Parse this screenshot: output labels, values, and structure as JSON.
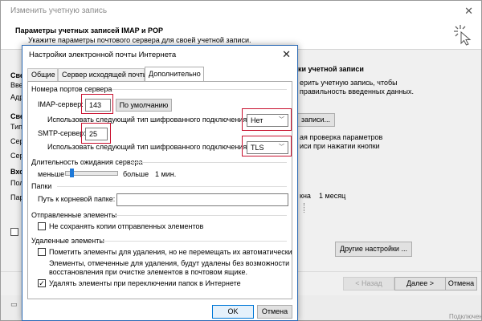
{
  "wizard": {
    "title": "Изменить учетную запись",
    "header_title": "Параметры учетных записей IMAP и POP",
    "header_subtitle": "Укажите параметры почтового сервера для своей учетной записи.",
    "left_fragments": [
      "Све",
      "Вве",
      "Адр",
      "Све",
      "Тип",
      "Сер",
      "Сер",
      "Вхо",
      "Пол",
      "Пар"
    ],
    "right": {
      "title": "ки учетной записи",
      "line1": "ерить учетную запись, чтобы",
      "line2": "правильность введенных данных.",
      "accounts_btn": "записи...",
      "auto_line1": "ая проверка параметров",
      "auto_line2": "иси при нажатии кнопки",
      "period": "кна",
      "period_value": "1 месяц"
    },
    "more_settings_btn": "Другие настройки ...",
    "back_btn": "< Назад",
    "next_btn": "Далее >",
    "cancel_btn": "Отмена",
    "bottom_right_text": "Подключение"
  },
  "dialog": {
    "title": "Настройки электронной почты Интернета",
    "tabs": [
      "Общие",
      "Сервер исходящей почты",
      "Дополнительно"
    ],
    "ports_group": "Номера портов сервера",
    "imap_label": "IMAP-сервер:",
    "imap_port": "143",
    "default_btn": "По умолчанию",
    "imap_enc_label": "Использовать следующий тип шифрованного подключения:",
    "imap_enc_value": "Нет",
    "smtp_label": "SMTP-сервер:",
    "smtp_port": "25",
    "smtp_enc_label": "Использовать следующий тип шифрованного подключения:",
    "smtp_enc_value": "TLS",
    "timeout_group": "Длительность ожидания сервера",
    "timeout_less": "меньше",
    "timeout_more": "больше",
    "timeout_value": "1 мин.",
    "timeout_level_fraction": 0.08,
    "folders_group": "Папки",
    "root_path_label": "Путь к корневой папке:",
    "root_path_value": "",
    "sent_group": "Отправленные элементы",
    "sent_no_copies": "Не сохранять копии отправленных элементов",
    "sent_no_copies_checked": false,
    "deleted_group": "Удаленные элементы",
    "mark_deleted": "Пометить элементы для удаления, но не перемещать их автоматически",
    "mark_deleted_checked": false,
    "mark_deleted_note1": "Элементы, отмеченные для удаления, будут удалены без возможности",
    "mark_deleted_note2": "восстановления при очистке элементов в почтовом ящике.",
    "delete_on_switch": "Удалять элементы при переключении папок в Интернете",
    "delete_on_switch_checked": true,
    "ok_btn": "OK",
    "cancel_btn": "Отмена"
  },
  "colors": {
    "highlight": "#c8102e",
    "accent": "#0078d7"
  }
}
